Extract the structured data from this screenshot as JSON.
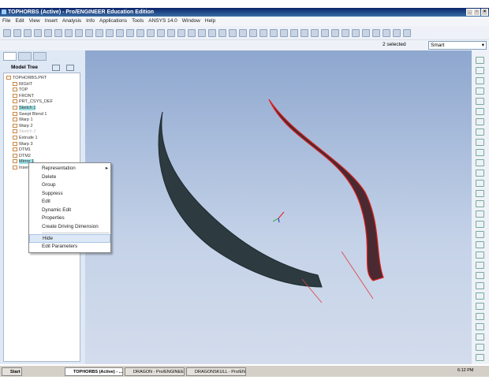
{
  "window": {
    "title": "TOPHORBS (Active) - Pro/ENGINEER Education Edition",
    "controls": [
      "_",
      "▫",
      "×"
    ]
  },
  "menu": [
    "File",
    "Edit",
    "View",
    "Insert",
    "Analysis",
    "Info",
    "Applications",
    "Tools",
    "ANSYS 14.0",
    "Window",
    "Help"
  ],
  "status": {
    "selected": "2 selected",
    "filter": "Smart"
  },
  "model_tree": {
    "header": "Model Tree",
    "items": [
      {
        "label": "TOPHORBS.PRT",
        "indent": 0
      },
      {
        "label": "RIGHT",
        "indent": 1
      },
      {
        "label": "TOP",
        "indent": 1
      },
      {
        "label": "FRONT",
        "indent": 1
      },
      {
        "label": "PRT_CSYS_DEF",
        "indent": 1
      },
      {
        "label": "Sketch 1",
        "indent": 1,
        "selected": true
      },
      {
        "label": "Swept Blend 1",
        "indent": 1
      },
      {
        "label": "Warp 1",
        "indent": 1
      },
      {
        "label": "Warp 2",
        "indent": 1
      },
      {
        "label": "Sketch 2",
        "indent": 1,
        "dim": true
      },
      {
        "label": "Extrude 1",
        "indent": 1
      },
      {
        "label": "Warp 3",
        "indent": 1
      },
      {
        "label": "DTM1",
        "indent": 1
      },
      {
        "label": "DTM2",
        "indent": 1
      },
      {
        "label": "Mirror 1",
        "indent": 1,
        "selected": true
      },
      {
        "label": "Insert",
        "indent": 1
      }
    ]
  },
  "context_menu": {
    "items": [
      {
        "label": "Representation",
        "submenu": "▸"
      },
      {
        "label": "Delete"
      },
      {
        "label": "Group"
      },
      {
        "label": "Suppress"
      },
      {
        "label": "Edit"
      },
      {
        "label": "Dynamic Edit"
      },
      {
        "label": "Properties"
      },
      {
        "label": "Create Driving Dimension"
      },
      {
        "label": "Hide",
        "highlighted": true
      },
      {
        "label": "Edit Parameters"
      }
    ]
  },
  "taskbar": {
    "start": "Start",
    "tasks": [
      "TOPHORBS (Active) - ...",
      "DRAGON - Pro/ENGINEE...",
      "DRAGONSKULL - Pro/EN..."
    ],
    "clock": "6:12 PM"
  },
  "colors": {
    "title_bar": "#0a246a",
    "viewport": "#a9bcdc",
    "highlight_edge": "#e02020",
    "model": "#2d3b40"
  }
}
